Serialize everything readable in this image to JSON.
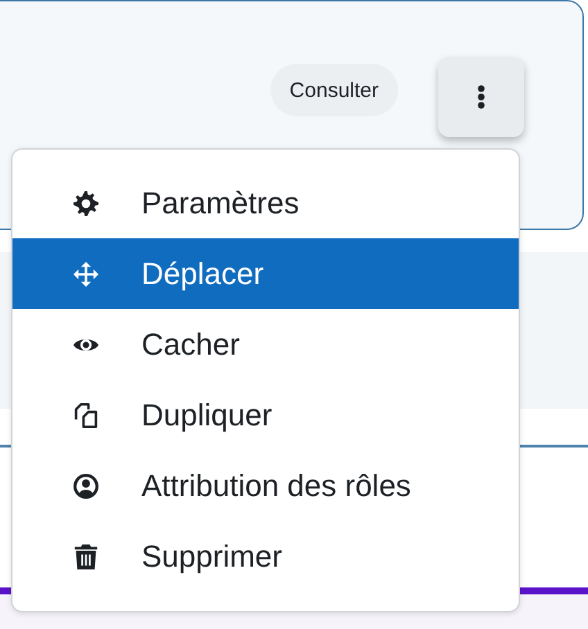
{
  "card": {
    "view_button": "Consulter",
    "more_button": {
      "expanded": true
    }
  },
  "menu": {
    "items": [
      {
        "label": "Paramètres",
        "kind": "gear",
        "selected": false
      },
      {
        "label": "Déplacer",
        "kind": "move",
        "selected": true
      },
      {
        "label": "Cacher",
        "kind": "eye",
        "selected": false
      },
      {
        "label": "Dupliquer",
        "kind": "copy",
        "selected": false
      },
      {
        "label": "Attribution des rôles",
        "kind": "user",
        "selected": false
      },
      {
        "label": "Supprimer",
        "kind": "trash",
        "selected": false
      }
    ]
  }
}
